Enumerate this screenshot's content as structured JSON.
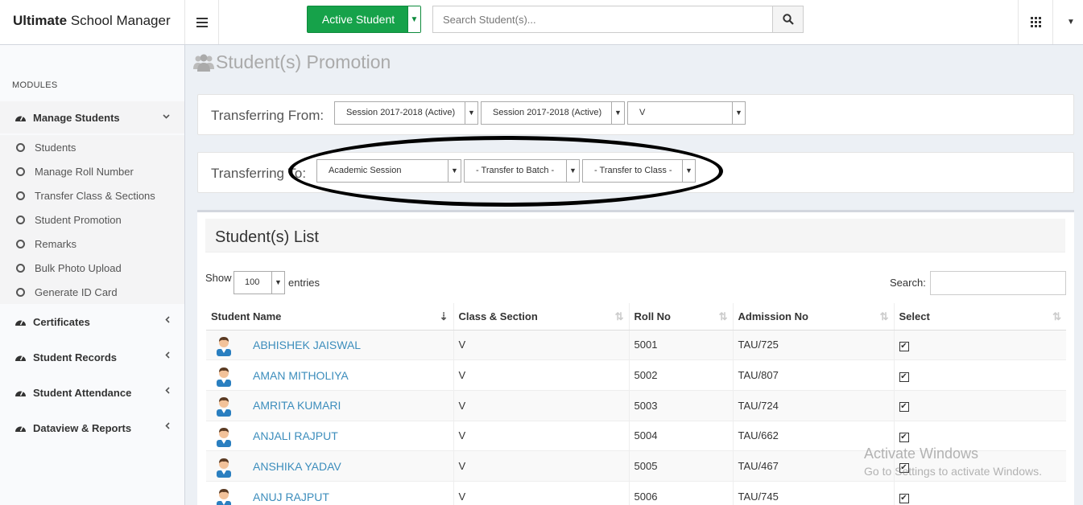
{
  "app": {
    "brand_bold": "Ultimate",
    "brand_rest": "School Manager"
  },
  "topbar": {
    "active_student_label": "Active Student",
    "search_placeholder": "Search Student(s)..."
  },
  "sidebar": {
    "modules_label": "MODULES",
    "groups": [
      {
        "label": "Manage Students",
        "expanded": true
      },
      {
        "label": "Certificates",
        "expanded": false
      },
      {
        "label": "Student Records",
        "expanded": false
      },
      {
        "label": "Student Attendance",
        "expanded": false
      },
      {
        "label": "Dataview & Reports",
        "expanded": false
      }
    ],
    "sub_items": [
      "Students",
      "Manage Roll Number",
      "Transfer Class & Sections",
      "Student Promotion",
      "Remarks",
      "Bulk Photo Upload",
      "Generate ID Card"
    ]
  },
  "page": {
    "title": "Student(s) Promotion"
  },
  "transfer_from": {
    "label": "Transferring From:",
    "session": "Session 2017-2018 (Active)",
    "batch": "Session 2017-2018 (Active)",
    "class": "V"
  },
  "transfer_to": {
    "label": "Transferring To:",
    "session": "Academic Session",
    "batch": "- Transfer to Batch -",
    "class": "- Transfer to Class -"
  },
  "list": {
    "title": "Student(s) List",
    "show_label": "Show",
    "entries_value": "100",
    "entries_label": "entries",
    "search_label": "Search:",
    "columns": [
      "Student Name",
      "Class & Section",
      "Roll No",
      "Admission No",
      "Select"
    ],
    "rows": [
      {
        "name": "ABHISHEK JAISWAL",
        "class": "V",
        "roll": "5001",
        "admission": "TAU/725",
        "selected": true
      },
      {
        "name": "AMAN MITHOLIYA",
        "class": "V",
        "roll": "5002",
        "admission": "TAU/807",
        "selected": true
      },
      {
        "name": "AMRITA KUMARI",
        "class": "V",
        "roll": "5003",
        "admission": "TAU/724",
        "selected": true
      },
      {
        "name": "ANJALI RAJPUT",
        "class": "V",
        "roll": "5004",
        "admission": "TAU/662",
        "selected": true
      },
      {
        "name": "ANSHIKA YADAV",
        "class": "V",
        "roll": "5005",
        "admission": "TAU/467",
        "selected": true
      },
      {
        "name": "ANUJ RAJPUT",
        "class": "V",
        "roll": "5006",
        "admission": "TAU/745",
        "selected": true
      }
    ]
  },
  "watermark": {
    "line1": "Activate Windows",
    "line2": "Go to Settings to activate Windows."
  }
}
